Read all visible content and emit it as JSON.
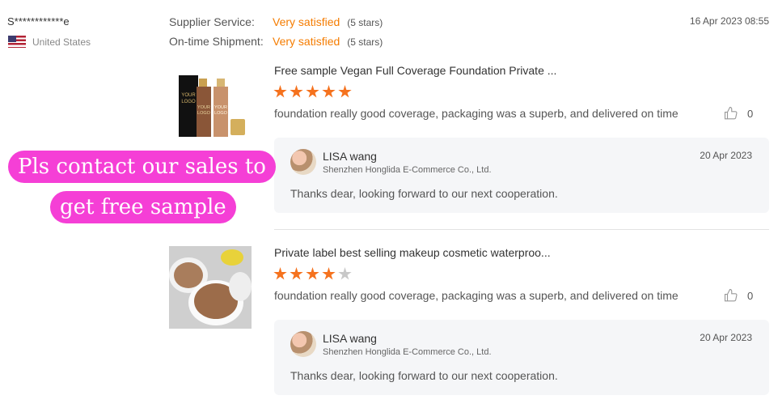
{
  "reviewer": {
    "name": "S************e",
    "country": "United States"
  },
  "ratings": [
    {
      "label": "Supplier Service:",
      "value": "Very satisfied",
      "stars": "(5 stars)"
    },
    {
      "label": "On-time Shipment:",
      "value": "Very satisfied",
      "stars": "(5 stars)"
    }
  ],
  "review_date": "16 Apr 2023 08:55",
  "products": [
    {
      "title": "Free sample Vegan Full Coverage Foundation Private ...",
      "rating": 5,
      "text": "foundation really good coverage, packaging was a superb, and delivered on time",
      "likes": "0",
      "image_labels": [
        "YOUR",
        "LOGO"
      ],
      "reply": {
        "name": "LISA wang",
        "company": "Shenzhen Honglida E-Commerce Co., Ltd.",
        "date": "20 Apr 2023",
        "text": "Thanks dear, looking forward to our next cooperation."
      }
    },
    {
      "title": "Private label best selling makeup cosmetic waterproo...",
      "rating": 4,
      "text": "foundation really good coverage, packaging was a superb, and delivered on time",
      "likes": "0",
      "reply": {
        "name": "LISA wang",
        "company": "Shenzhen Honglida E-Commerce Co., Ltd.",
        "date": "20 Apr 2023",
        "text": "Thanks dear, looking forward to our next cooperation."
      }
    }
  ],
  "promo": {
    "line1": "Pls contact our sales to",
    "line2": "get free sample"
  },
  "colors": {
    "accent": "#f57c00",
    "star": "#f5721e",
    "promo": "#f53fd6"
  }
}
